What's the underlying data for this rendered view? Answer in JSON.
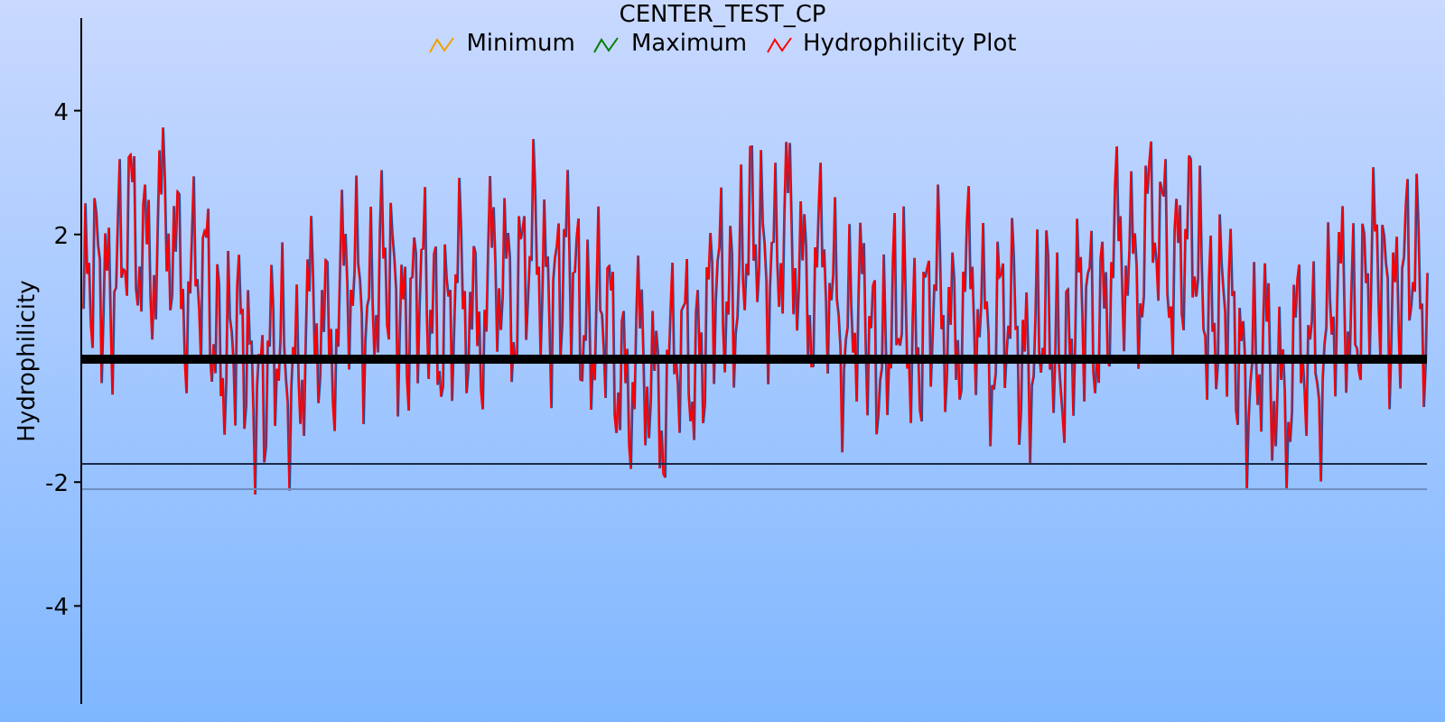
{
  "title": "CENTER_TEST_CP",
  "legend": [
    {
      "label": "Minimum",
      "color": "#f0a000"
    },
    {
      "label": "Maximum",
      "color": "#008000"
    },
    {
      "label": "Hydrophilicity Plot",
      "color": "#ff0000"
    }
  ],
  "y_axis": {
    "label": "Hydrophilicity",
    "ticks": [
      "4",
      "2",
      "-2",
      "-4"
    ]
  }
}
